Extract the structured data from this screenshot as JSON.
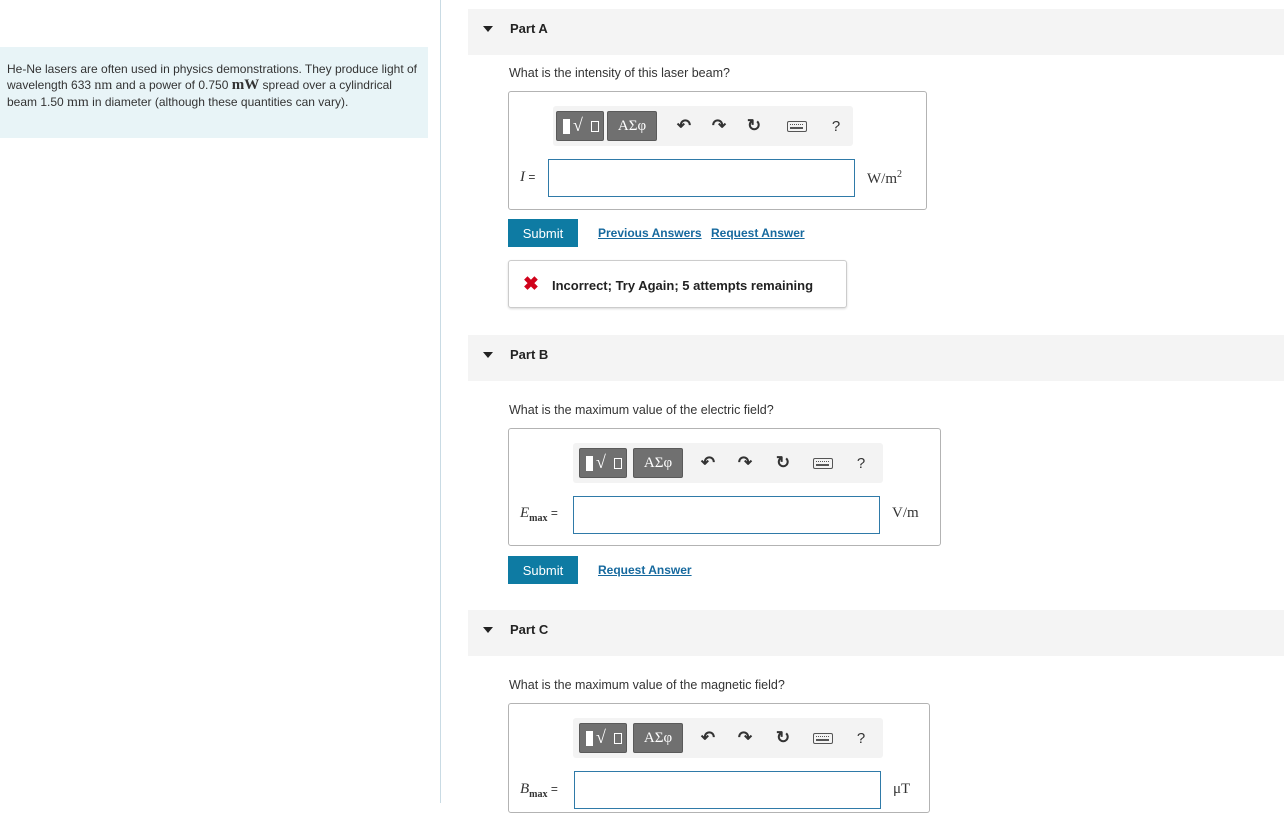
{
  "intro": {
    "t1": "He-Ne lasers are often used in physics demonstrations. They produce light of wavelength 633 ",
    "u1": "nm",
    "t2": " and a power of 0.750 ",
    "u2": "mW",
    "t3": " spread over a cylindrical beam 1.50 ",
    "u3": "mm",
    "t4": " in diameter (although these quantities can vary)."
  },
  "toolbar": {
    "greek_label": "ΑΣφ",
    "undo_icon": "undo-icon",
    "redo_icon": "redo-icon",
    "reset_icon": "reset-icon",
    "keyboard_icon": "keyboard-icon",
    "help_label": "?"
  },
  "parts": {
    "a": {
      "title": "Part A",
      "question": "What is the intensity of this laser beam?",
      "var": "I",
      "eq": " =",
      "value": "",
      "unit": "W/m",
      "unit_sup": "2",
      "submit": "Submit",
      "prev_answers": "Previous Answers",
      "request_answer": "Request Answer",
      "feedback": "Incorrect; Try Again; 5 attempts remaining"
    },
    "b": {
      "title": "Part B",
      "question": "What is the maximum value of the electric field?",
      "var": "E",
      "sub": "max",
      "eq": " =",
      "value": "",
      "unit": "V/m",
      "submit": "Submit",
      "request_answer": "Request Answer"
    },
    "c": {
      "title": "Part C",
      "question": "What is the maximum value of the magnetic field?",
      "var": "B",
      "sub": "max",
      "eq": " =",
      "value": "",
      "unit": "μT"
    }
  },
  "colors": {
    "intro_bg": "#e8f4f7",
    "submit_bg": "#0e7ba3",
    "link": "#16699e",
    "error": "#d0021b"
  }
}
